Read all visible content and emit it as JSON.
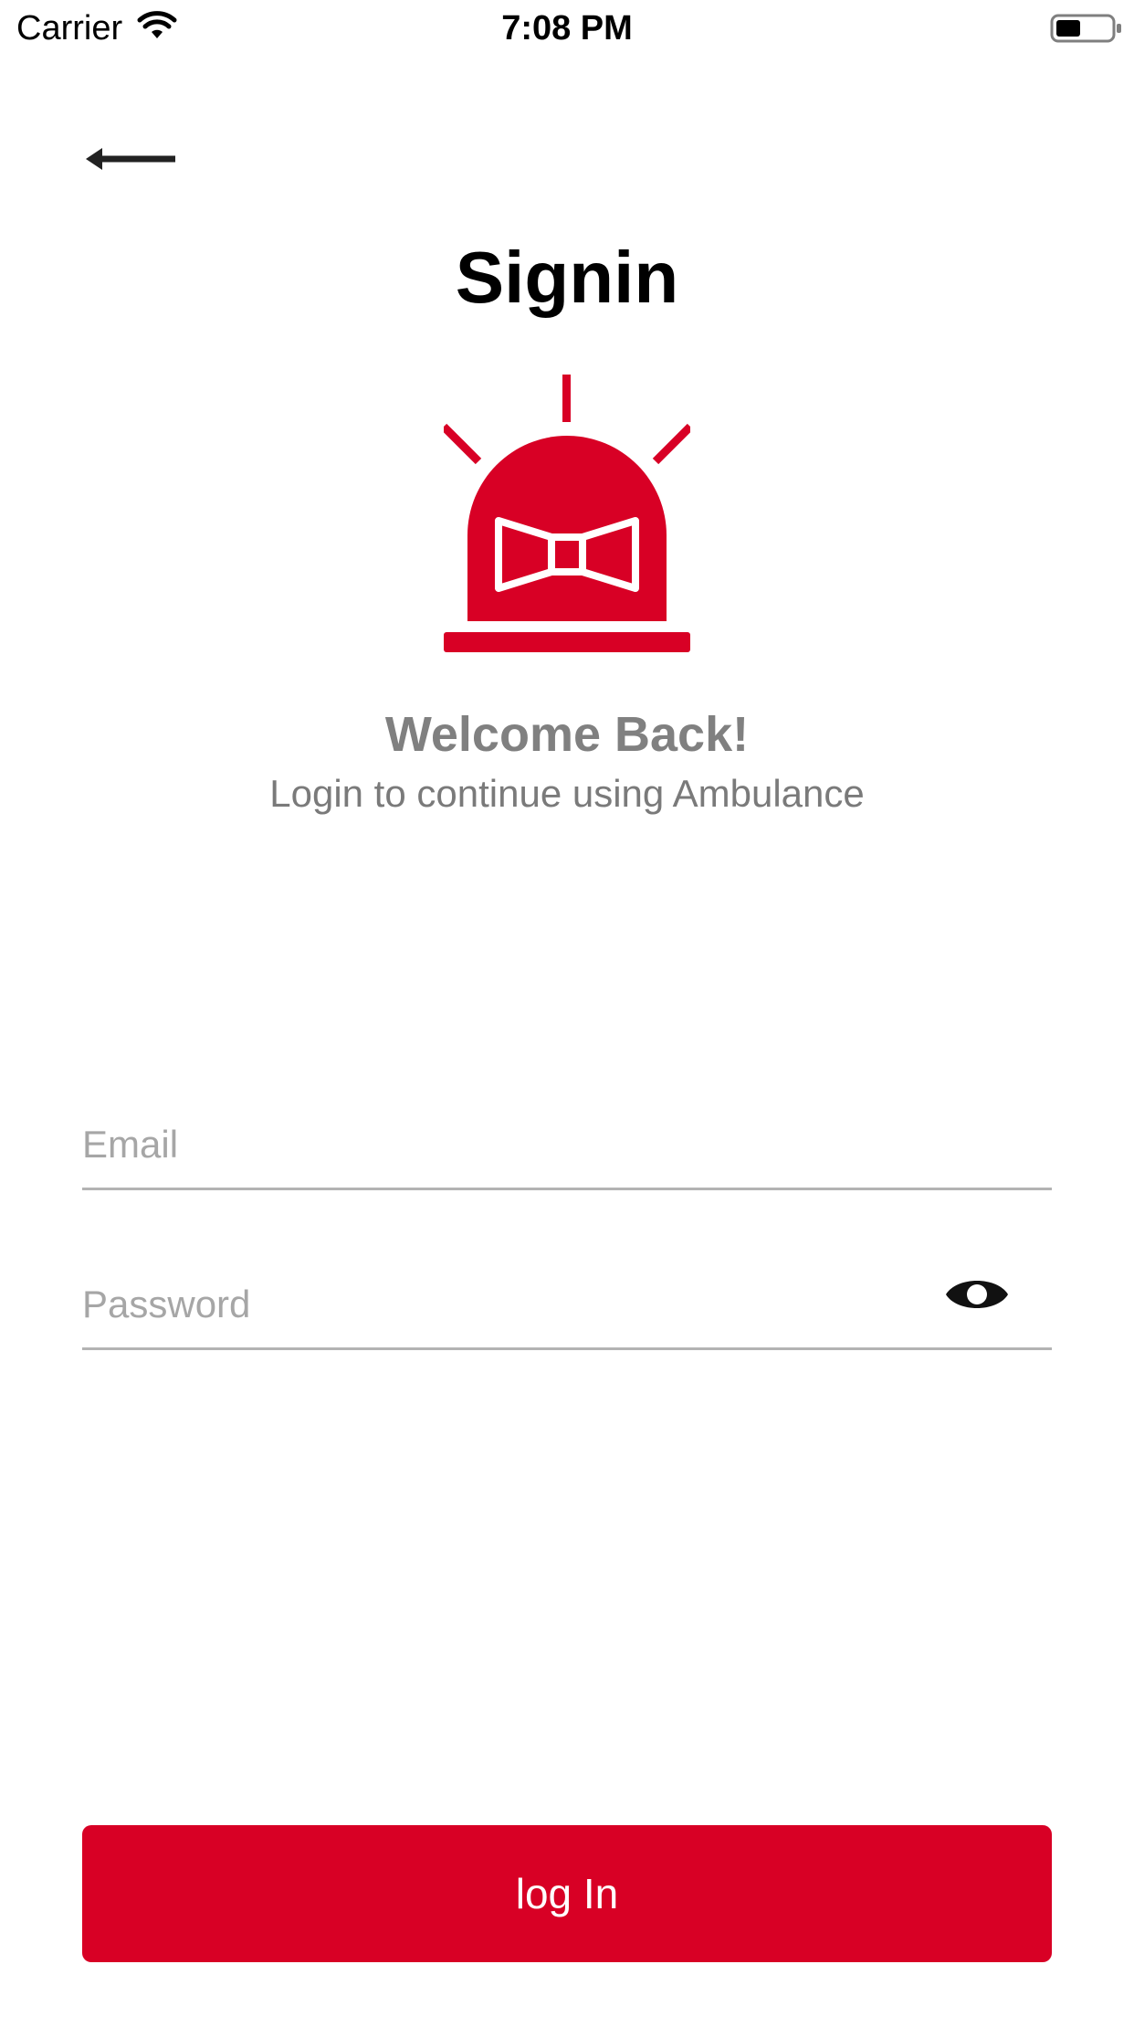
{
  "status_bar": {
    "carrier": "Carrier",
    "time": "7:08 PM",
    "battery_level": 0.45
  },
  "header": {
    "back_icon": "arrow-left-icon",
    "title": "Signin"
  },
  "logo": {
    "icon": "siren-icon",
    "color": "#d80025"
  },
  "welcome": {
    "heading": "Welcome Back!",
    "subtitle": "Login to continue using Ambulance"
  },
  "form": {
    "email": {
      "placeholder": "Email",
      "value": ""
    },
    "password": {
      "placeholder": "Password",
      "value": "",
      "toggle_icon": "eye-icon"
    }
  },
  "actions": {
    "login_label": "log In"
  },
  "colors": {
    "accent": "#d80025",
    "muted_text": "#808080",
    "underline": "#b3b3b3"
  }
}
